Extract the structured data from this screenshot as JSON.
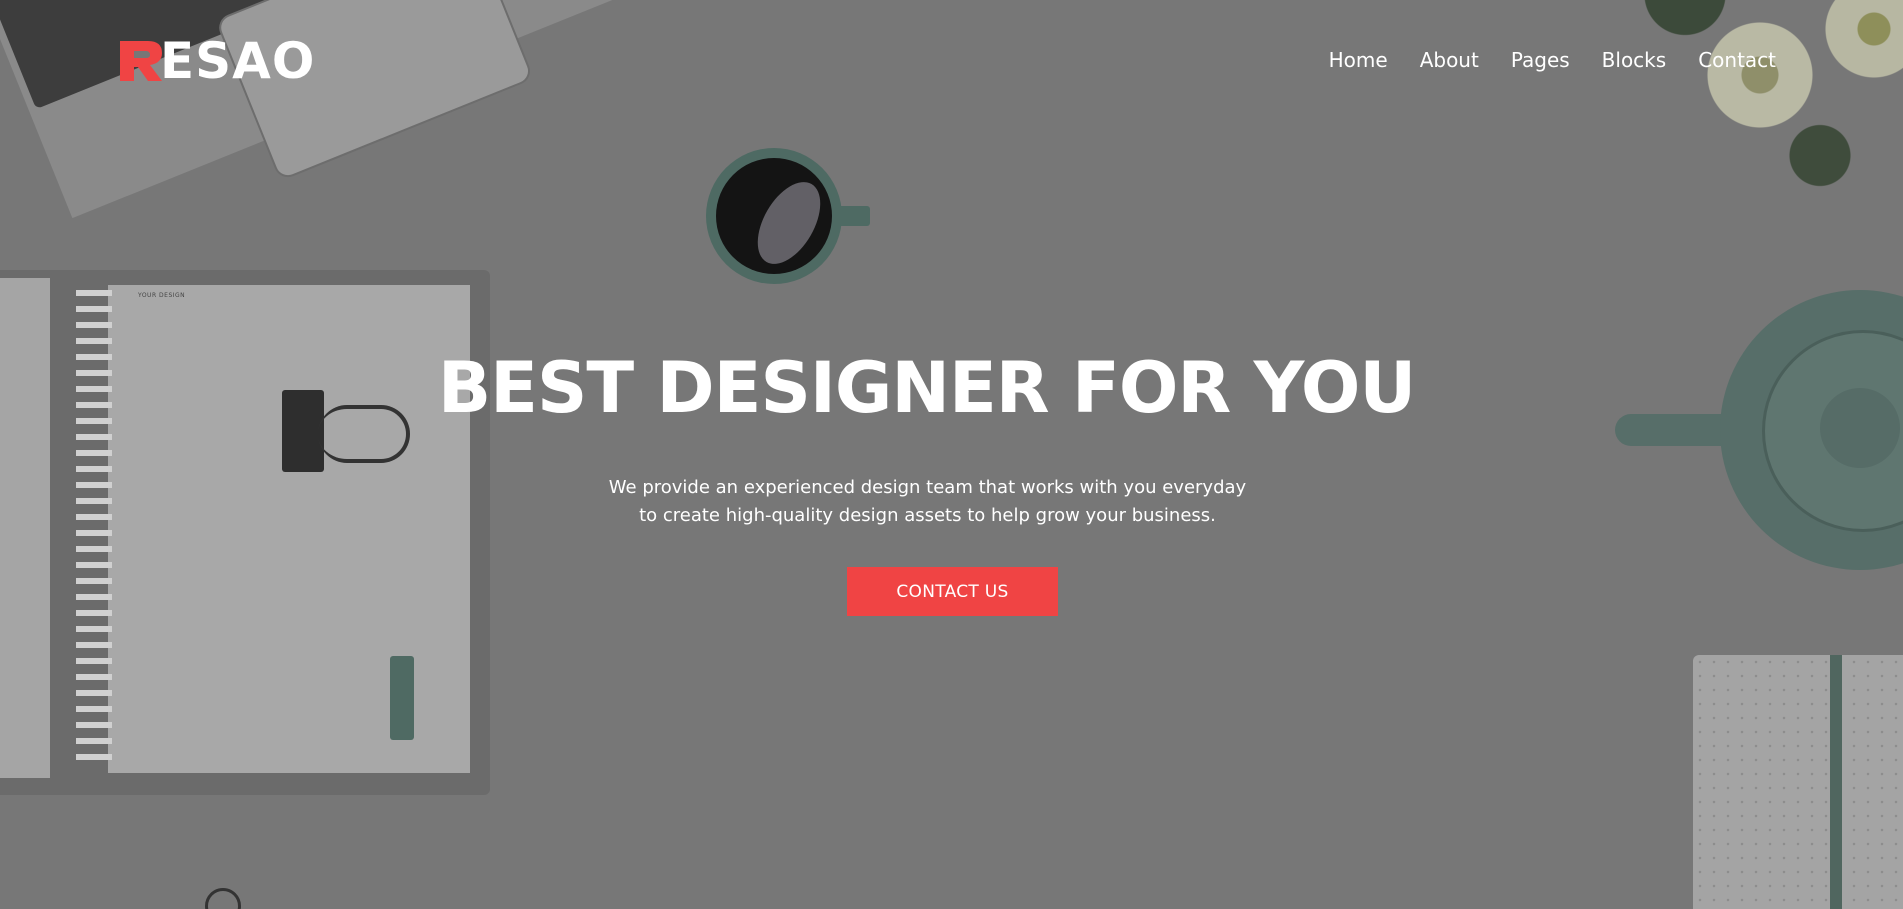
{
  "brand": {
    "name": "ESAO",
    "accent_color": "#f04444",
    "logo_icon": "r-logo-mark"
  },
  "nav": {
    "items": [
      {
        "label": "Home"
      },
      {
        "label": "About"
      },
      {
        "label": "Pages"
      },
      {
        "label": "Blocks"
      },
      {
        "label": "Contact"
      }
    ]
  },
  "hero": {
    "headline": "BEST DESIGNER FOR YOU",
    "subtitle_line1": "We provide an experienced design team that works with you everyday",
    "subtitle_line2": "to create high-quality design assets to help grow your business.",
    "cta_label": "CONTACT US",
    "notebook_label": "YOUR DESIGN"
  }
}
